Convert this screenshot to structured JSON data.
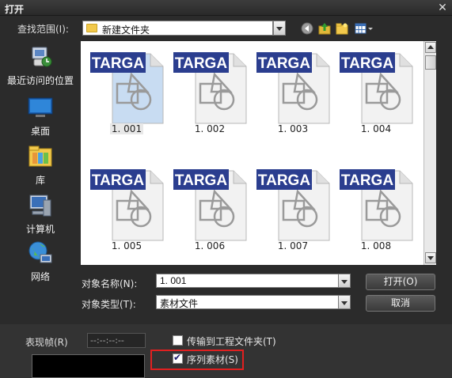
{
  "window": {
    "title": "打开"
  },
  "lookin": {
    "label": "查找范围(I):",
    "value": "新建文件夹"
  },
  "places": [
    {
      "label": "最近访问的位置",
      "icon": "recent-places-icon"
    },
    {
      "label": "桌面",
      "icon": "desktop-icon"
    },
    {
      "label": "库",
      "icon": "library-icon"
    },
    {
      "label": "计算机",
      "icon": "computer-icon"
    },
    {
      "label": "网络",
      "icon": "network-icon"
    }
  ],
  "files": [
    {
      "name": "1. 001",
      "badge": "TARGA",
      "selected": true
    },
    {
      "name": "1. 002",
      "badge": "TARGA"
    },
    {
      "name": "1. 003",
      "badge": "TARGA"
    },
    {
      "name": "1. 004",
      "badge": "TARGA"
    },
    {
      "name": "1. 005",
      "badge": "TARGA"
    },
    {
      "name": "1. 006",
      "badge": "TARGA"
    },
    {
      "name": "1. 007",
      "badge": "TARGA"
    },
    {
      "name": "1. 008",
      "badge": "TARGA"
    }
  ],
  "filename": {
    "label": "对象名称(N):",
    "value": "1. 001"
  },
  "filetype": {
    "label": "对象类型(T):",
    "value": "素材文件"
  },
  "buttons": {
    "open": "打开(O)",
    "cancel": "取消"
  },
  "frame": {
    "label": "表现帧(R)",
    "value": "--:--:--:--"
  },
  "options": {
    "transfer": {
      "label": "传输到工程文件夹(T)",
      "checked": false
    },
    "sequence": {
      "label": "序列素材(S)",
      "checked": true
    }
  },
  "colors": {
    "badge": "#2b3e8f",
    "highlight": "#e02020",
    "selected_thumb": "#c8dcf2"
  }
}
